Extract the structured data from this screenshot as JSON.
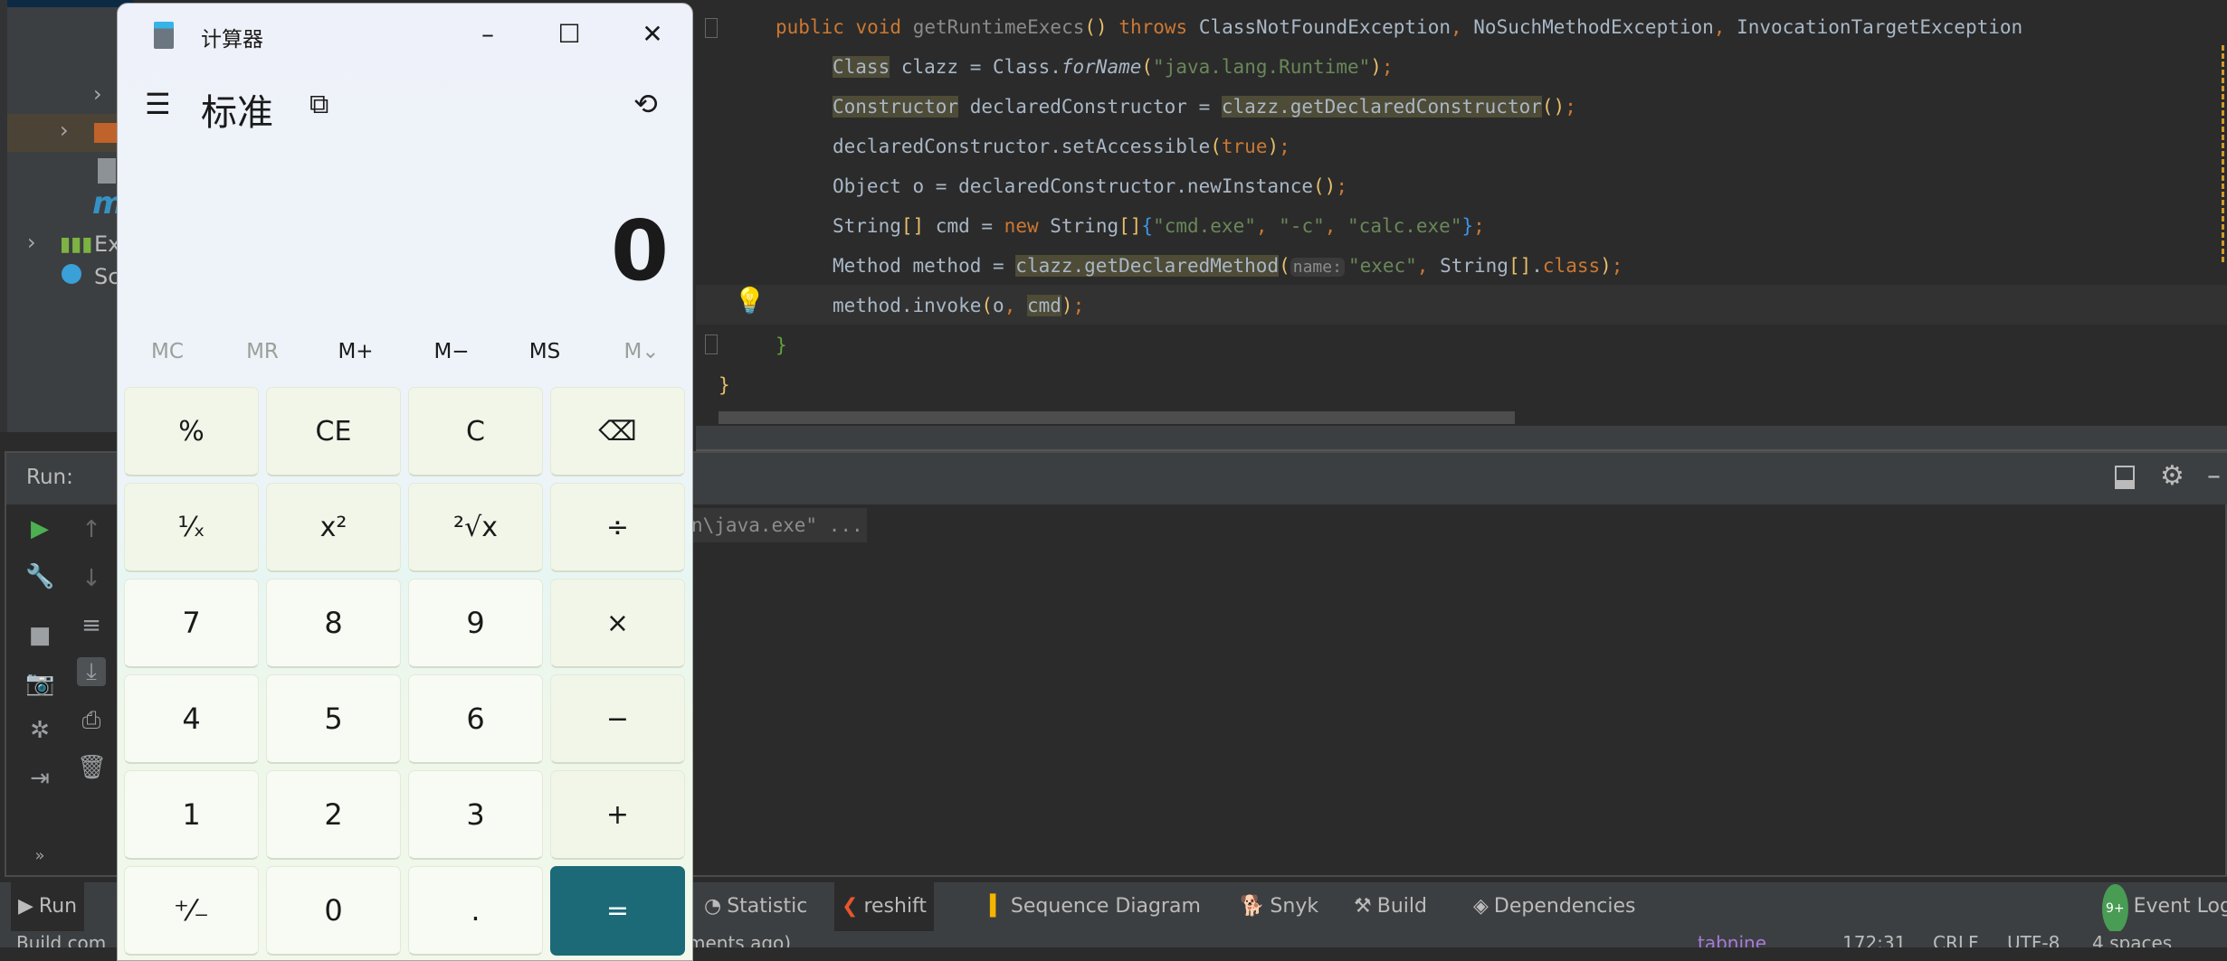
{
  "project_tree": {
    "items": [
      {
        "label": "Ext"
      },
      {
        "label": "Scr"
      }
    ],
    "m_label": "m"
  },
  "editor": {
    "lines": [
      [
        {
          "t": "public void ",
          "c": "kw"
        },
        {
          "t": "getRuntimeExecs",
          "c": "unused"
        },
        {
          "t": "()",
          "c": "paren"
        },
        {
          "t": " throws ",
          "c": "kw"
        },
        {
          "t": "ClassNotFoundException",
          "c": ""
        },
        {
          "t": ", ",
          "c": "kw"
        },
        {
          "t": "NoSuchMethodException",
          "c": ""
        },
        {
          "t": ", ",
          "c": "kw"
        },
        {
          "t": "InvocationTargetException",
          "c": ""
        }
      ],
      [
        {
          "t": "Class",
          "c": "hl"
        },
        {
          "t": " clazz = Class.",
          "c": ""
        },
        {
          "t": "forName",
          "c": "it"
        },
        {
          "t": "(",
          "c": "paren"
        },
        {
          "t": "\"java.lang.Runtime\"",
          "c": "str"
        },
        {
          "t": ")",
          "c": "paren"
        },
        {
          "t": ";",
          "c": "kw"
        }
      ],
      [
        {
          "t": "Constructor",
          "c": "hl"
        },
        {
          "t": " declaredConstructor = ",
          "c": ""
        },
        {
          "t": "clazz.getDeclaredConstructor",
          "c": "hl"
        },
        {
          "t": "()",
          "c": "paren"
        },
        {
          "t": ";",
          "c": "kw"
        }
      ],
      [
        {
          "t": "declaredConstructor.setAccessible",
          "c": ""
        },
        {
          "t": "(",
          "c": "paren"
        },
        {
          "t": "true",
          "c": "kw"
        },
        {
          "t": ")",
          "c": "paren"
        },
        {
          "t": ";",
          "c": "kw"
        }
      ],
      [
        {
          "t": "Object o = declaredConstructor.newInstance",
          "c": ""
        },
        {
          "t": "()",
          "c": "paren"
        },
        {
          "t": ";",
          "c": "kw"
        }
      ],
      [
        {
          "t": "String",
          "c": ""
        },
        {
          "t": "[]",
          "c": "paren"
        },
        {
          "t": " cmd = ",
          "c": ""
        },
        {
          "t": "new ",
          "c": "kw"
        },
        {
          "t": "String",
          "c": ""
        },
        {
          "t": "[]",
          "c": "paren"
        },
        {
          "t": "{",
          "c": "brace"
        },
        {
          "t": "\"cmd.exe\"",
          "c": "str"
        },
        {
          "t": ", ",
          "c": "kw"
        },
        {
          "t": "\"-c\"",
          "c": "str"
        },
        {
          "t": ", ",
          "c": "kw"
        },
        {
          "t": "\"calc.exe\"",
          "c": "str"
        },
        {
          "t": "}",
          "c": "brace"
        },
        {
          "t": ";",
          "c": "kw"
        }
      ],
      [
        {
          "t": "Method method = ",
          "c": ""
        },
        {
          "t": "clazz.getDeclaredMethod",
          "c": "hl"
        },
        {
          "t": "(",
          "c": "paren"
        },
        {
          "t": "name:",
          "c": "hint"
        },
        {
          "t": "\"exec\"",
          "c": "str"
        },
        {
          "t": ", ",
          "c": "kw"
        },
        {
          "t": "String",
          "c": ""
        },
        {
          "t": "[]",
          "c": "paren"
        },
        {
          "t": ".",
          "c": ""
        },
        {
          "t": "class",
          "c": "kw"
        },
        {
          "t": ")",
          "c": "paren"
        },
        {
          "t": ";",
          "c": "kw"
        }
      ],
      [
        {
          "t": "method.invoke",
          "c": ""
        },
        {
          "t": "(",
          "c": "paren"
        },
        {
          "t": "o",
          "c": ""
        },
        {
          "t": ", ",
          "c": "kw"
        },
        {
          "t": "cmd",
          "c": "hl"
        },
        {
          "t": ")",
          "c": "paren"
        },
        {
          "t": ";",
          "c": "kw"
        }
      ],
      [
        {
          "t": "}",
          "c": "green"
        }
      ],
      [
        {
          "t": "}",
          "c": "yel"
        }
      ]
    ]
  },
  "run_panel": {
    "title": "Run:",
    "console_text": "n\\java.exe\" ..."
  },
  "toolbar": {
    "run": "Run",
    "items": [
      "Statistic",
      "reshift",
      "Sequence Diagram",
      "Snyk",
      "Build",
      "Dependencies"
    ],
    "event_log": "Event Log",
    "event_badge": "9+"
  },
  "status": {
    "left": "Build com",
    "middle": "ments ago)",
    "tabnine": "tabnine",
    "position": "172:31",
    "line_sep": "CRLF",
    "encoding": "UTF-8",
    "indent": "4 spaces"
  },
  "calculator": {
    "title": "计算器",
    "mode": "标准",
    "display": "0",
    "memory": [
      {
        "l": "MC",
        "on": false
      },
      {
        "l": "MR",
        "on": false
      },
      {
        "l": "M+",
        "on": true
      },
      {
        "l": "M−",
        "on": true
      },
      {
        "l": "MS",
        "on": true
      },
      {
        "l": "M⌄",
        "on": false
      }
    ],
    "keys": [
      [
        "%",
        "CE",
        "C",
        "⌫"
      ],
      [
        "¹⁄ₓ",
        "x²",
        "²√x",
        "÷"
      ],
      [
        "7",
        "8",
        "9",
        "×"
      ],
      [
        "4",
        "5",
        "6",
        "−"
      ],
      [
        "1",
        "2",
        "3",
        "+"
      ],
      [
        "⁺⁄₋",
        "0",
        ".",
        "="
      ]
    ],
    "accent": "#1c6a78"
  }
}
